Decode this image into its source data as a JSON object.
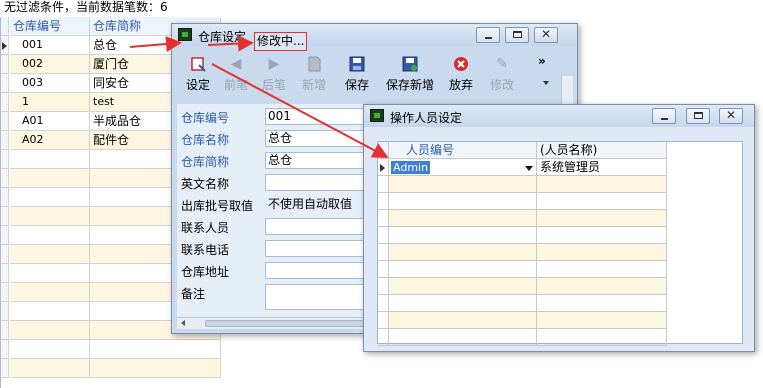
{
  "status": {
    "text": "无过滤条件，当前数据笔数：6"
  },
  "warehouse_list": {
    "headers": [
      "仓库编号",
      "仓库简称"
    ],
    "rows": [
      {
        "code": "001",
        "name": "总仓"
      },
      {
        "code": "002",
        "name": "厦门仓"
      },
      {
        "code": "003",
        "name": "同安仓"
      },
      {
        "code": "1",
        "name": "test"
      },
      {
        "code": "A01",
        "name": "半成品仓"
      },
      {
        "code": "A02",
        "name": "配件仓"
      }
    ]
  },
  "warehouse_window": {
    "title": "仓库设定",
    "mode": "修改中...",
    "toolbar": [
      {
        "label": "设定",
        "icon": "settings-icon",
        "enabled": true
      },
      {
        "label": "前笔",
        "icon": "arrow-left-icon",
        "enabled": false
      },
      {
        "label": "后笔",
        "icon": "arrow-right-icon",
        "enabled": false
      },
      {
        "label": "新增",
        "icon": "new-document-icon",
        "enabled": false
      },
      {
        "label": "保存",
        "icon": "save-icon",
        "enabled": true
      },
      {
        "label": "保存新增",
        "icon": "save-new-icon",
        "enabled": true
      },
      {
        "label": "放弃",
        "icon": "cancel-icon",
        "enabled": true
      },
      {
        "label": "修改",
        "icon": "edit-tools-icon",
        "enabled": false
      }
    ],
    "more": "»",
    "fields": [
      {
        "label": "仓库编号",
        "value": "001",
        "required": true
      },
      {
        "label": "仓库名称",
        "value": "总仓",
        "required": true
      },
      {
        "label": "仓库简称",
        "value": "总仓",
        "required": true
      },
      {
        "label": "英文名称",
        "value": "",
        "required": false
      },
      {
        "label": "出库批号取值",
        "value": "不使用自动取值",
        "required": false
      },
      {
        "label": "联系人员",
        "value": "",
        "required": false
      },
      {
        "label": "联系电话",
        "value": "",
        "required": false
      },
      {
        "label": "仓库地址",
        "value": "",
        "required": false
      },
      {
        "label": "备注",
        "value": "",
        "required": false
      }
    ]
  },
  "operator_window": {
    "title": "操作人员设定",
    "columns": [
      "人员编号",
      "(人员名称)"
    ],
    "rows": [
      {
        "code": "Admin",
        "name": "系统管理员"
      }
    ]
  },
  "colors": {
    "accent_blue": "#2a5caa",
    "alt_row": "#fdf7e2",
    "annotation_red": "#e23131",
    "selection": "#3c7fd6"
  }
}
